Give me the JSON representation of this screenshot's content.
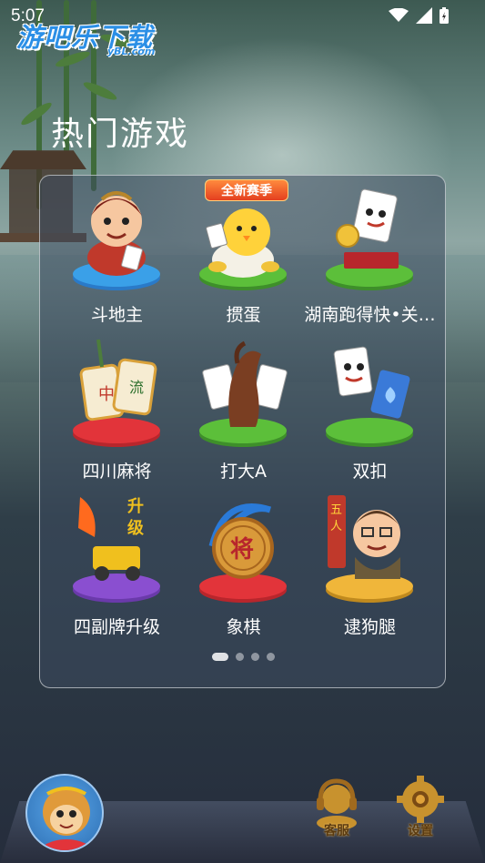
{
  "status_bar": {
    "time": "5:07",
    "icons": [
      "wifi-icon",
      "signal-icon",
      "battery-charging-icon"
    ]
  },
  "watermark": {
    "title": "游吧乐下载",
    "subtitle": "yBL.com"
  },
  "section_title": "热门游戏",
  "games": [
    {
      "label": "斗地主",
      "icon": "doudizhu-icon"
    },
    {
      "label": "掼蛋",
      "icon": "guandan-icon",
      "badge": "全新赛季"
    },
    {
      "label": "湖南跑得快•关…",
      "icon": "paodekuai-icon"
    },
    {
      "label": "四川麻将",
      "icon": "mahjong-icon"
    },
    {
      "label": "打大A",
      "icon": "dada-icon"
    },
    {
      "label": "双扣",
      "icon": "shuangkou-icon"
    },
    {
      "label": "四副牌升级",
      "icon": "shengji-icon"
    },
    {
      "label": "象棋",
      "icon": "xiangqi-icon"
    },
    {
      "label": "逮狗腿",
      "icon": "daigoutui-icon"
    }
  ],
  "pager": {
    "total": 4,
    "active": 1
  },
  "bottom_bar": {
    "customer_service_label": "客服",
    "settings_label": "设置"
  },
  "colors": {
    "watermark_blue": "#2b8fe6",
    "badge_orange": "#e43f1f",
    "platform_blue": "#3aa0e8",
    "platform_green": "#5cbf3a",
    "platform_red": "#e2343a",
    "platform_purple": "#8a4fd0",
    "platform_gold": "#f0b63a"
  }
}
